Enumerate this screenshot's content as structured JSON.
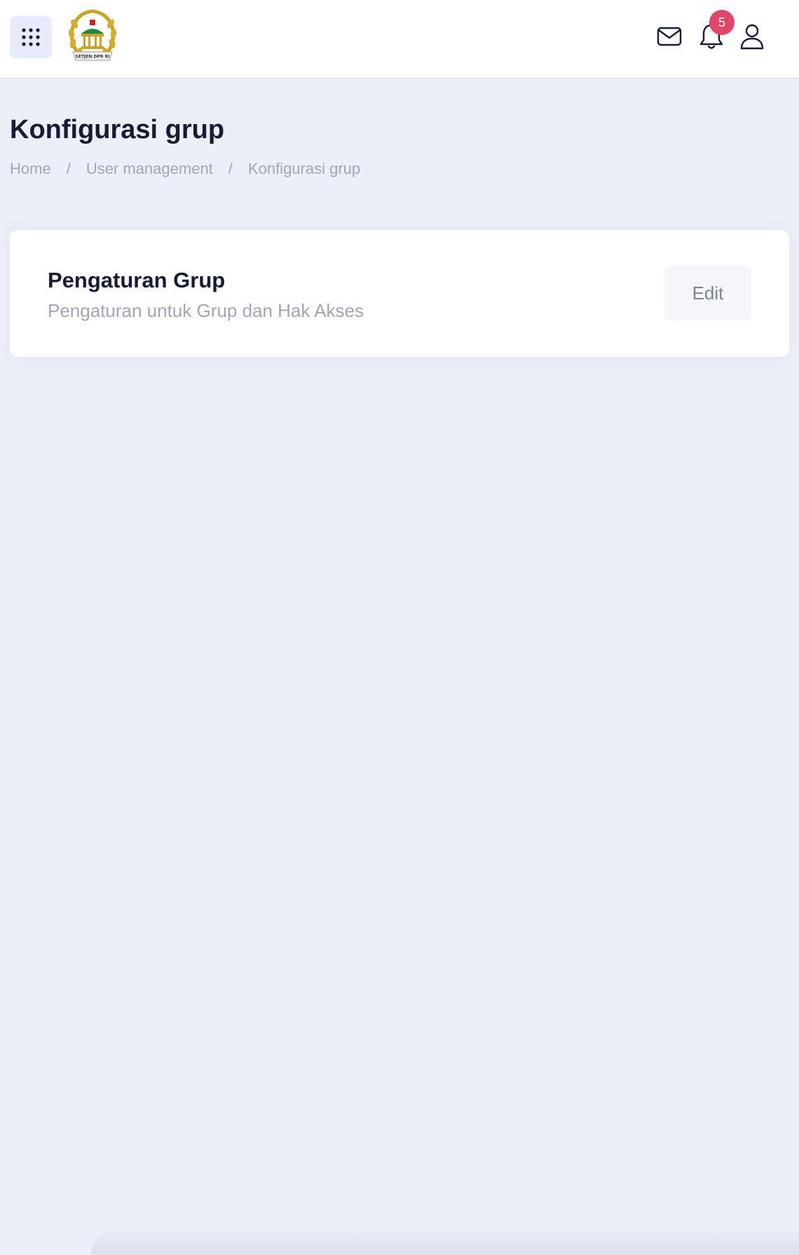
{
  "header": {
    "logo_text": "SETJEN DPR RI",
    "icons": {
      "menu": "grid-dots-icon",
      "mail": "mail-icon",
      "notifications": "bell-icon",
      "user": "user-icon"
    },
    "notification_count": "5"
  },
  "page": {
    "title": "Konfigurasi grup",
    "breadcrumb": [
      "Home",
      "User management",
      "Konfigurasi grup"
    ],
    "breadcrumb_separator": "/"
  },
  "card": {
    "title": "Pengaturan Grup",
    "subtitle": "Pengaturan untuk Grup dan Hak Akses",
    "edit_label": "Edit"
  },
  "colors": {
    "page_background": "#eceff8",
    "badge": "#e0456a",
    "text_primary": "#181c32",
    "text_muted": "#a1a5b7"
  }
}
